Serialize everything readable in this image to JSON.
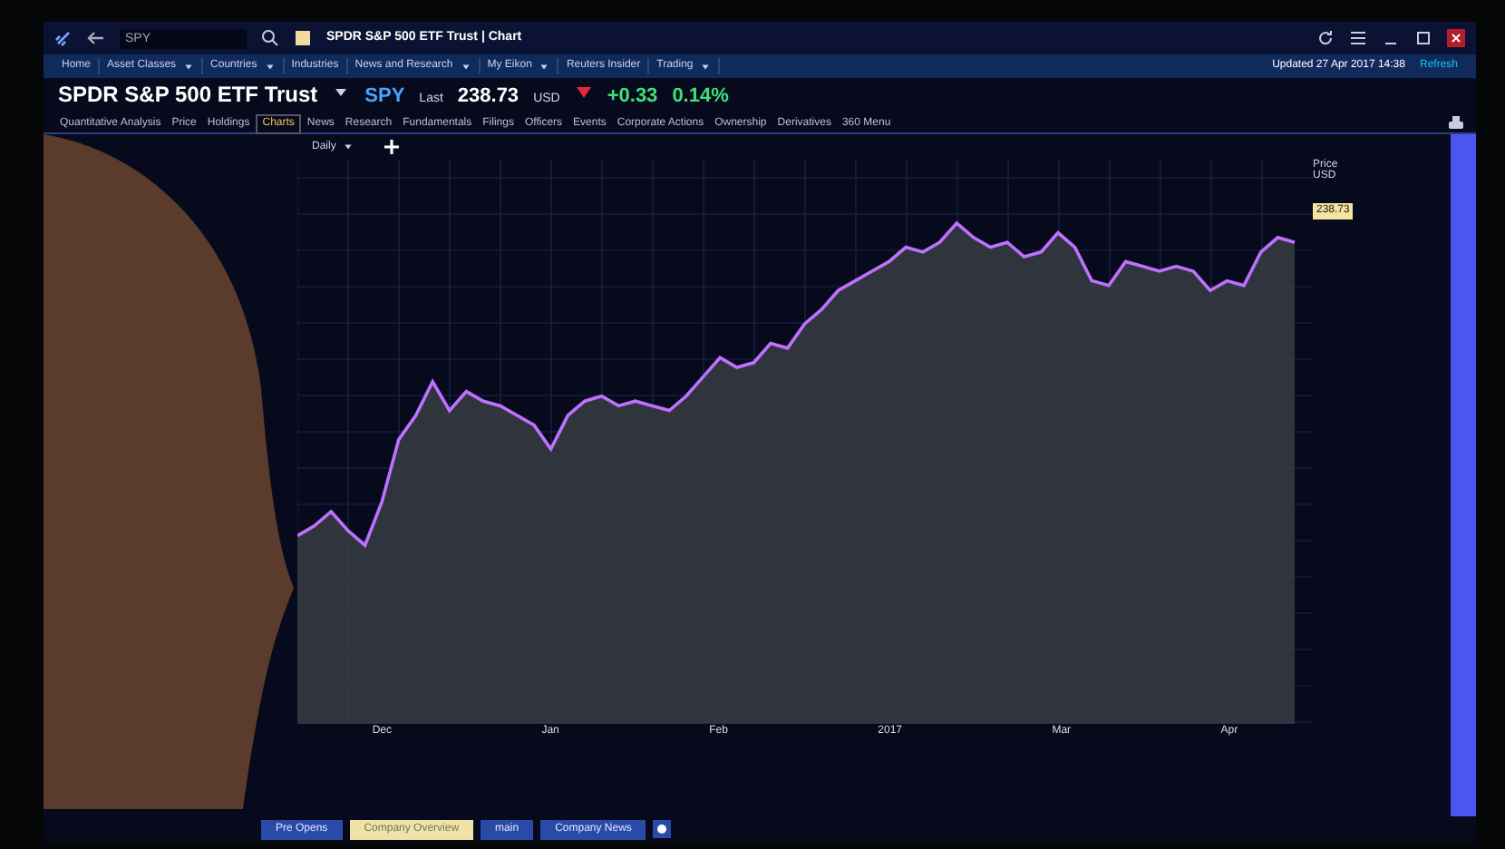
{
  "window": {
    "search": {
      "value": "SPY"
    },
    "title": "SPDR S&P 500 ETF Trust | Chart"
  },
  "status": {
    "updated": "Updated 27 Apr 2017 14:38",
    "refresh": "Refresh"
  },
  "menu": [
    {
      "label": "Home",
      "dropdown": false
    },
    {
      "label": "Asset Classes",
      "dropdown": true
    },
    {
      "label": "Countries",
      "dropdown": true
    },
    {
      "label": "Industries",
      "dropdown": false
    },
    {
      "label": "News and Research",
      "dropdown": true
    },
    {
      "label": "My Eikon",
      "dropdown": true
    },
    {
      "label": "Reuters Insider",
      "dropdown": false
    },
    {
      "label": "Trading",
      "dropdown": true
    }
  ],
  "quote": {
    "name": "SPDR S&P 500 ETF Trust",
    "ticker": "SPY",
    "last_label": "Last",
    "last": "238.73",
    "currency": "USD",
    "change": "+0.33",
    "change_pct": "0.14%"
  },
  "tabs": [
    {
      "label": "Quantitative Analysis",
      "selected": false
    },
    {
      "label": "Price",
      "selected": false
    },
    {
      "label": "Holdings",
      "selected": false
    },
    {
      "label": "Charts",
      "selected": true
    },
    {
      "label": "News",
      "selected": false
    },
    {
      "label": "Research",
      "selected": false
    },
    {
      "label": "Fundamentals",
      "selected": false
    },
    {
      "label": "Filings",
      "selected": false
    },
    {
      "label": "Officers",
      "selected": false
    },
    {
      "label": "Events",
      "selected": false
    },
    {
      "label": "Corporate Actions",
      "selected": false
    },
    {
      "label": "Ownership",
      "selected": false
    },
    {
      "label": "Derivatives",
      "selected": false
    },
    {
      "label": "360 Menu",
      "selected": false
    }
  ],
  "chart": {
    "interval": "Daily",
    "axis_label": "Price USD",
    "price_tag": "238.73",
    "x_labels": [
      "Dec",
      "Jan",
      "Feb",
      "2017",
      "Mar",
      "Apr"
    ]
  },
  "taskbar": [
    {
      "label": "Pre Opens",
      "selected": false
    },
    {
      "label": "Company Overview",
      "selected": true
    },
    {
      "label": "main",
      "selected": false
    },
    {
      "label": "Company News",
      "selected": false
    }
  ]
}
